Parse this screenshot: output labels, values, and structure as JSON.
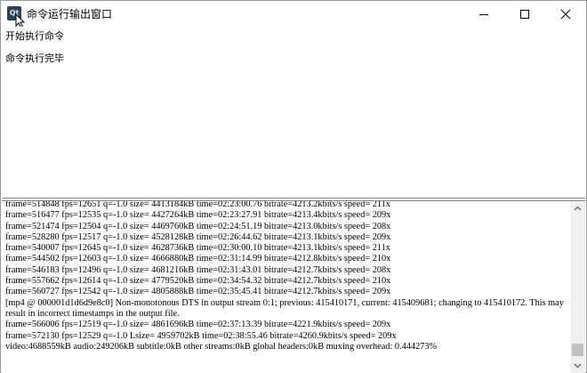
{
  "window": {
    "title": "命令运行输出窗口",
    "app_icon_text": "Qt"
  },
  "upper_output": {
    "lines": [
      "开始执行命令",
      "命令执行完毕"
    ]
  },
  "log_output": {
    "lines": [
      "frame=514848 fps=12651 q=-1.0 size= 4413184kB time=02:23:00.76 bitrate=4213.2kbits/s speed= 211x",
      "frame=516477 fps=12535 q=-1.0 size= 4427264kB time=02:23:27.91 bitrate=4213.4kbits/s speed= 209x",
      "frame=521474 fps=12504 q=-1.0 size= 4469760kB time=02:24:51.19 bitrate=4213.0kbits/s speed= 208x",
      "frame=528280 fps=12517 q=-1.0 size= 4528128kB time=02:26:44.62 bitrate=4213.1kbits/s speed= 209x",
      "frame=540007 fps=12645 q=-1.0 size= 4628736kB time=02:30:00.10 bitrate=4213.1kbits/s speed= 211x",
      "frame=544502 fps=12603 q=-1.0 size= 4666880kB time=02:31:14.99 bitrate=4212.8kbits/s speed= 210x",
      "frame=546183 fps=12496 q=-1.0 size= 4681216kB time=02:31:43.01 bitrate=4212.7kbits/s speed= 208x",
      "frame=557662 fps=12614 q=-1.0 size= 4779520kB time=02:34:54.32 bitrate=4212.7kbits/s speed= 210x",
      "frame=560727 fps=12542 q=-1.0 size= 4805888kB time=02:35:45.41 bitrate=4212.7kbits/s speed= 209x",
      "[mp4 @ 000001d1d6d9e8c0] Non-monotonous DTS in output stream 0:1; previous: 415410171, current: 415409681; changing to 415410172. This may result in incorrect timestamps in the output file.",
      "frame=566006 fps=12519 q=-1.0 size= 4861696kB time=02:37:13.39 bitrate=4221.9kbits/s speed= 209x",
      "frame=572130 fps=12529 q=-1.0 Lsize= 4959702kB time=02:38:55.46 bitrate=4260.9kbits/s speed= 209x",
      "video:4688559kB audio:249206kB subtitle:0kB other streams:0kB global headers:0kB muxing overhead: 0.444273%"
    ]
  },
  "colors": {
    "app_icon_bg": "#2d4256",
    "scrollbar_track": "#f0f0f0",
    "scrollbar_thumb": "#c1c1c1"
  }
}
